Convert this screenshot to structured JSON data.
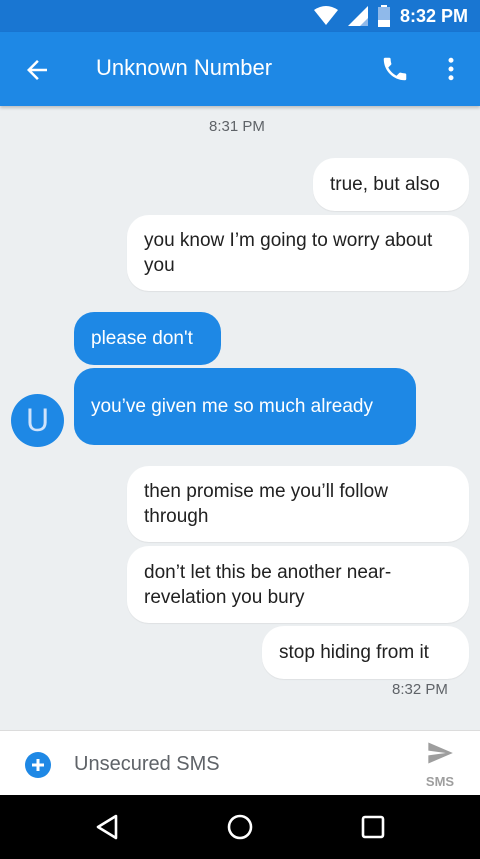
{
  "status_bar": {
    "time": "8:32 PM"
  },
  "app_bar": {
    "title": "Unknown Number"
  },
  "conversation": {
    "timestamps": [
      "8:31 PM",
      "8:32 PM"
    ],
    "messages": [
      {
        "direction": "outgoing",
        "text": "true, but also"
      },
      {
        "direction": "outgoing",
        "text": "you know I’m going to worry about you"
      },
      {
        "direction": "incoming",
        "text": "please don't"
      },
      {
        "direction": "incoming",
        "text": "you’ve given me so much already"
      },
      {
        "direction": "outgoing",
        "text": "then promise me you’ll follow through"
      },
      {
        "direction": "outgoing",
        "text": "don’t let this be another near-revelation you bury"
      },
      {
        "direction": "outgoing",
        "text": "stop hiding from it"
      }
    ],
    "avatar_letter": "U"
  },
  "composer": {
    "placeholder": "Unsecured SMS",
    "send_label": "SMS"
  },
  "colors": {
    "status_bar": "#1976d2",
    "app_bar": "#1e88e5",
    "incoming_bubble": "#1e88e5",
    "outgoing_bubble": "#ffffff",
    "background": "#eceff1"
  },
  "icons": [
    "wifi-icon",
    "signal-icon",
    "battery-icon",
    "back-arrow-icon",
    "phone-icon",
    "more-vert-icon",
    "add-icon",
    "send-icon",
    "nav-back-icon",
    "nav-home-icon",
    "nav-recents-icon"
  ]
}
